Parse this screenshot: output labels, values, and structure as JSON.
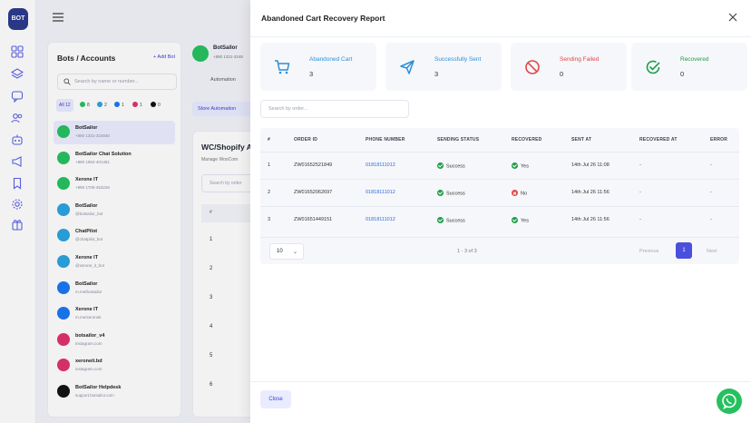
{
  "app": {
    "logo_text": "BOT"
  },
  "bots_panel": {
    "title": "Bots / Accounts",
    "add_label": "+ Add Bot",
    "search_placeholder": "Search by name or number...",
    "filters": [
      {
        "label": "All 12",
        "active": true
      },
      {
        "label": "8",
        "platform": "whatsapp"
      },
      {
        "label": "2",
        "platform": "telegram"
      },
      {
        "label": "1",
        "platform": "messenger"
      },
      {
        "label": "1",
        "platform": "instagram"
      },
      {
        "label": "0",
        "platform": "tiktok"
      }
    ],
    "items": [
      {
        "name": "BotSailor",
        "sub": "+880 1331-324840",
        "platform": "whatsapp",
        "color": "#25c15f",
        "selected": true
      },
      {
        "name": "BotSailor Chat Solution",
        "sub": "+880 1962-401481",
        "platform": "whatsapp",
        "color": "#25c15f"
      },
      {
        "name": "Xerone IT",
        "sub": "+880 1705-453226",
        "platform": "whatsapp",
        "color": "#25c15f"
      },
      {
        "name": "BotSailor",
        "sub": "@botsailor_bot",
        "platform": "telegram",
        "color": "#2aa3e0"
      },
      {
        "name": "ChatPilot",
        "sub": "@chatpilot_bot",
        "platform": "telegram",
        "color": "#2aa3e0"
      },
      {
        "name": "Xerone IT",
        "sub": "@xerone_it_bot",
        "platform": "telegram",
        "color": "#2aa3e0"
      },
      {
        "name": "BotSailor",
        "sub": "m.me/botsailor",
        "platform": "facebook",
        "color": "#1877f2"
      },
      {
        "name": "Xerone IT",
        "sub": "m.me/xeroneit",
        "platform": "facebook",
        "color": "#1877f2"
      },
      {
        "name": "botsailor_v4",
        "sub": "instagram.com",
        "platform": "instagram",
        "color": "#e1306c"
      },
      {
        "name": "xeroneit.bd",
        "sub": "instagram.com",
        "platform": "instagram",
        "color": "#e1306c"
      },
      {
        "name": "BotSailor Helpdesk",
        "sub": "support.botsailor.com",
        "platform": "webchat",
        "color": "#111111"
      }
    ]
  },
  "background": {
    "bot_name": "BotSailor",
    "bot_phone": "+880 1331-3248",
    "automation_label": "Automation",
    "store_automation_label": "Store Automation",
    "card_title": "WC/Shopify A",
    "card_subtitle": "Manage WooCom",
    "card_search": "Search by order",
    "card_header": "#",
    "rows": [
      "1",
      "2",
      "3",
      "4",
      "5",
      "6"
    ]
  },
  "modal": {
    "title": "Abandoned Cart Recovery Report",
    "stats": [
      {
        "label": "Abandoned Cart",
        "value": "3",
        "color": "#2c8fd6",
        "icon": "cart-icon"
      },
      {
        "label": "Successfully Sent",
        "value": "3",
        "color": "#2c8fd6",
        "icon": "send-icon"
      },
      {
        "label": "Sending Failed",
        "value": "0",
        "color": "#e04747",
        "icon": "ban-icon"
      },
      {
        "label": "Recovered",
        "value": "0",
        "color": "#1f9d49",
        "icon": "check-circle-icon"
      }
    ],
    "search_placeholder": "Search by order...",
    "columns": [
      "#",
      "ORDER ID",
      "PHONE NUMBER",
      "SENDING STATUS",
      "RECOVERED",
      "SENT AT",
      "RECOVERED AT",
      "ERROR"
    ],
    "rows": [
      {
        "num": "1",
        "order_id": "ZW01652521849",
        "phone": "01818111012",
        "status": "Success",
        "recovered": "Yes",
        "recovered_ok": true,
        "sent_at": "14th Jul 26 11:08",
        "recovered_at": "-",
        "error": "-"
      },
      {
        "num": "2",
        "order_id": "ZW01652062697",
        "phone": "01818111012",
        "status": "Success",
        "recovered": "No",
        "recovered_ok": false,
        "sent_at": "14th Jul 26 11:56",
        "recovered_at": "-",
        "error": "-"
      },
      {
        "num": "3",
        "order_id": "ZW01651449151",
        "phone": "01818111012",
        "status": "Success",
        "recovered": "Yes",
        "recovered_ok": true,
        "sent_at": "14th Jul 26 11:56",
        "recovered_at": "-",
        "error": "-"
      }
    ],
    "pagination": {
      "page_size": "10",
      "info": "1 - 3 of 3",
      "previous": "Previous",
      "current": "1",
      "next": "Next"
    },
    "close_label": "Close"
  },
  "colors": {
    "accent": "#4b4fde",
    "whatsapp": "#25c15f",
    "success": "#1f9d49",
    "danger": "#e04747",
    "link": "#2b6cd6"
  }
}
